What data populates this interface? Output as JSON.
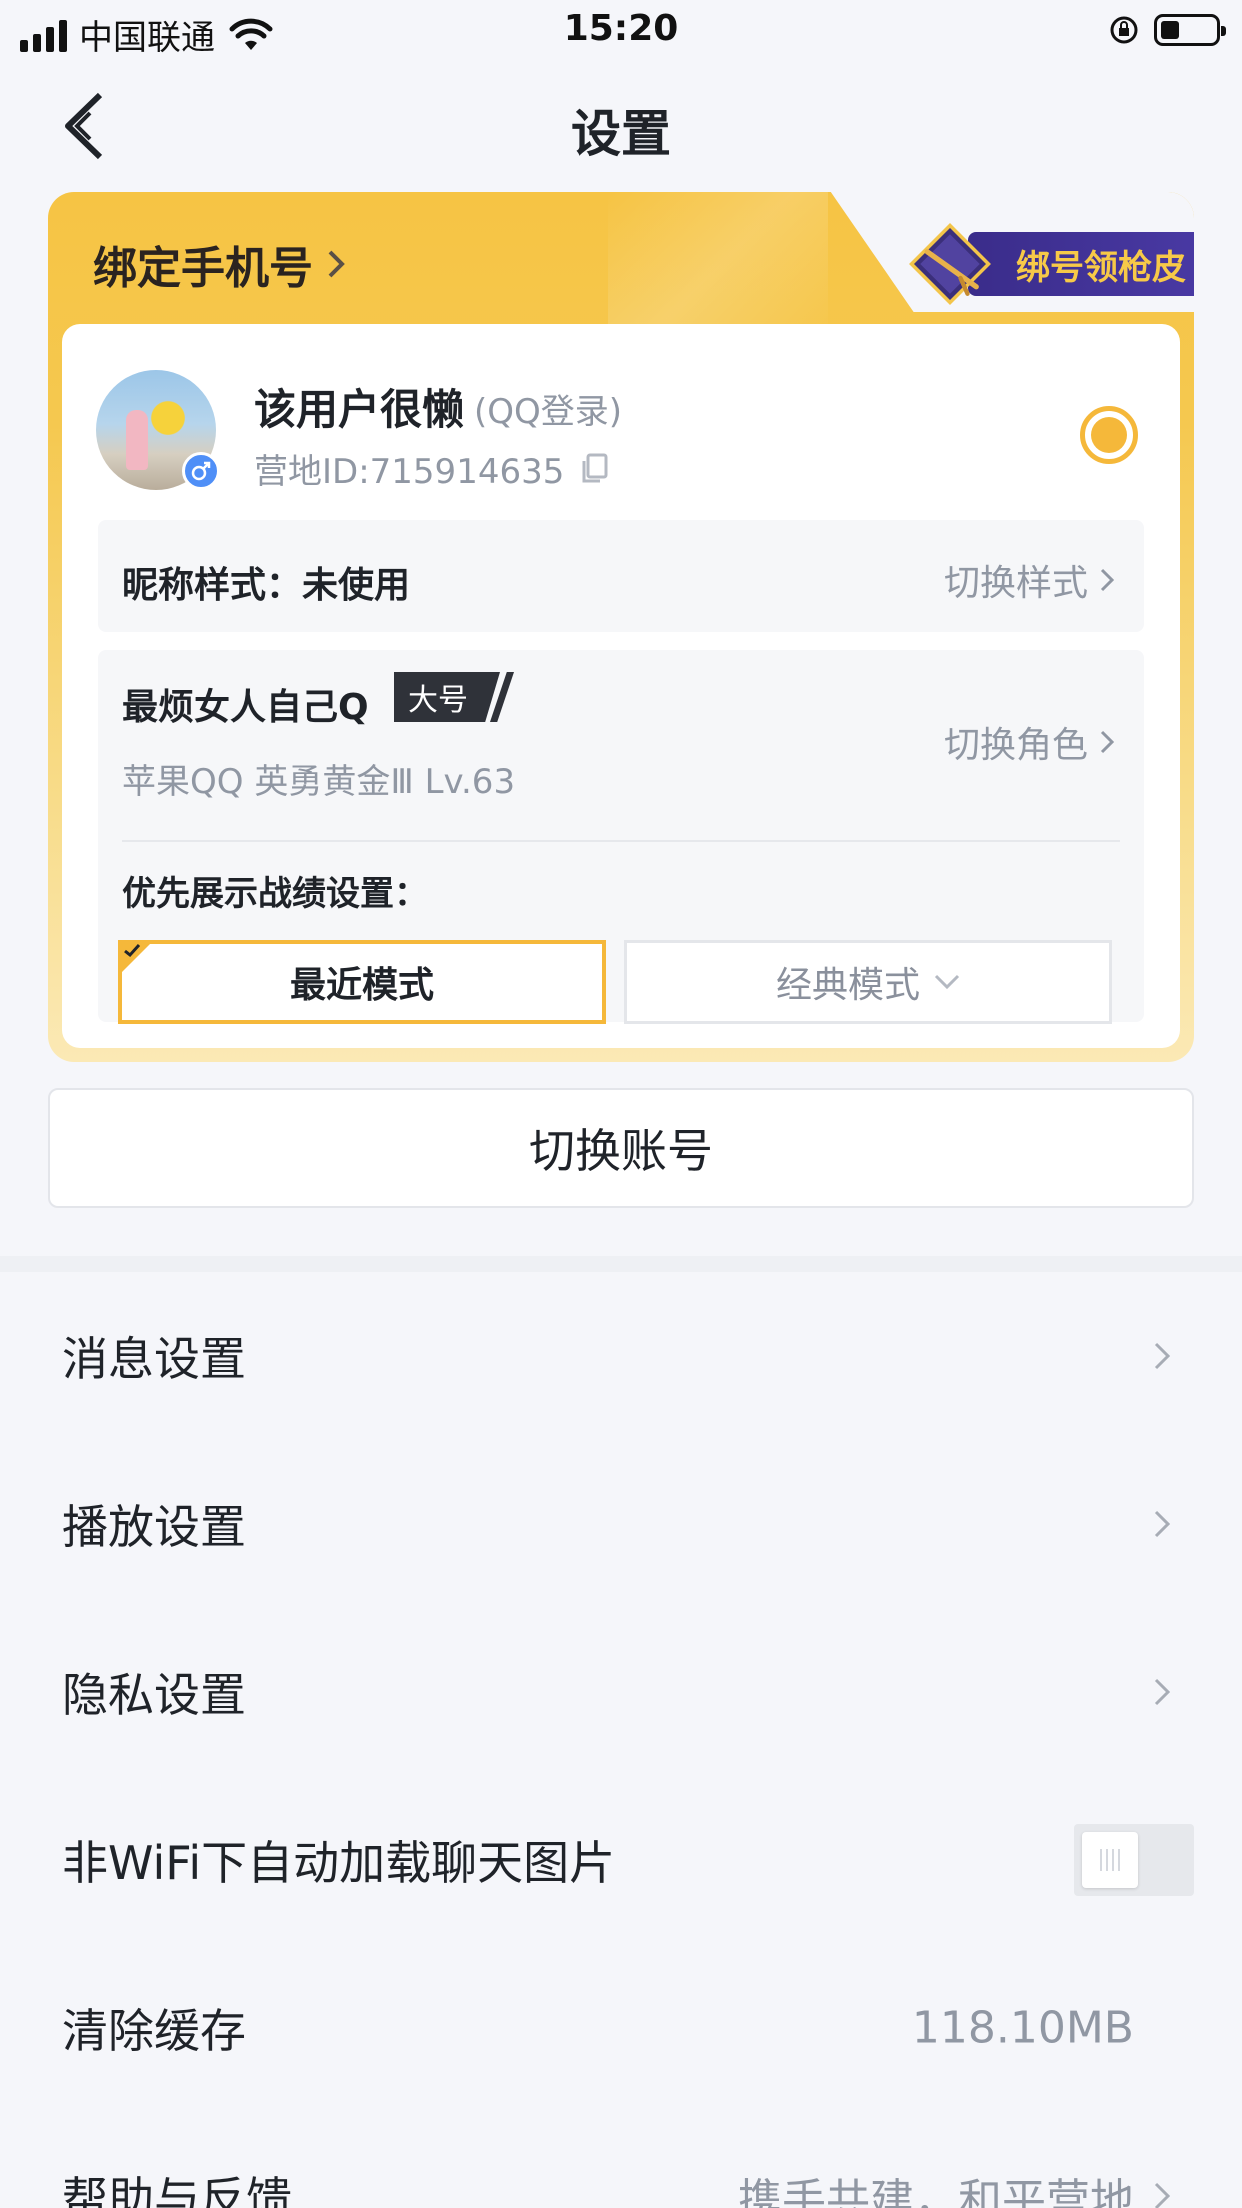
{
  "status_bar": {
    "carrier": "中国联通",
    "time": "15:20"
  },
  "nav": {
    "title": "设置"
  },
  "account_card": {
    "bind_phone_label": "绑定手机号",
    "skin_badge_label": "绑号领枪皮",
    "username": "该用户很懒",
    "login_type": "(QQ登录)",
    "camp_id": "营地ID:715914635",
    "nickname_style_label": "昵称样式：未使用",
    "nickname_style_action": "切换样式",
    "role_name": "最烦女人自己Q",
    "role_tag": "大号",
    "role_meta": "苹果QQ  英勇黄金Ⅲ  Lv.63",
    "role_action": "切换角色",
    "prefer_label": "优先展示战绩设置：",
    "mode_recent": "最近模式",
    "mode_classic": "经典模式"
  },
  "switch_account_label": "切换账号",
  "settings": {
    "message": "消息设置",
    "playback": "播放设置",
    "privacy": "隐私设置",
    "auto_load": "非WiFi下自动加载聊天图片",
    "auto_load_enabled": false,
    "clear_cache": "清除缓存",
    "cache_size": "118.10MB",
    "help": "帮助与反馈",
    "help_value": "携手共建，和平营地"
  },
  "colors": {
    "accent": "#f5b83a",
    "card_yellow": "#f6c444",
    "badge_purple": "#3a2c8a",
    "muted_text": "#9097a3"
  }
}
